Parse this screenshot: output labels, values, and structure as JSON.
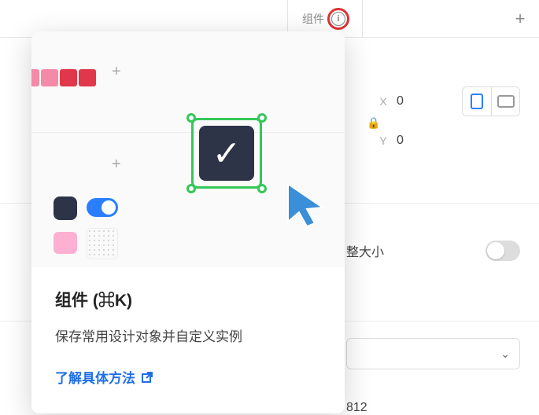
{
  "tab": {
    "label": "组件",
    "info_icon": "info-icon"
  },
  "inspector": {
    "x_label": "X",
    "x_value": "0",
    "y_label": "Y",
    "y_value": "0",
    "resize_label": "整大小",
    "number_field": "812"
  },
  "popover": {
    "title": "组件 (⌘K)",
    "description": "保存常用设计对象并自定义实例",
    "link_label": "了解具体方法"
  }
}
